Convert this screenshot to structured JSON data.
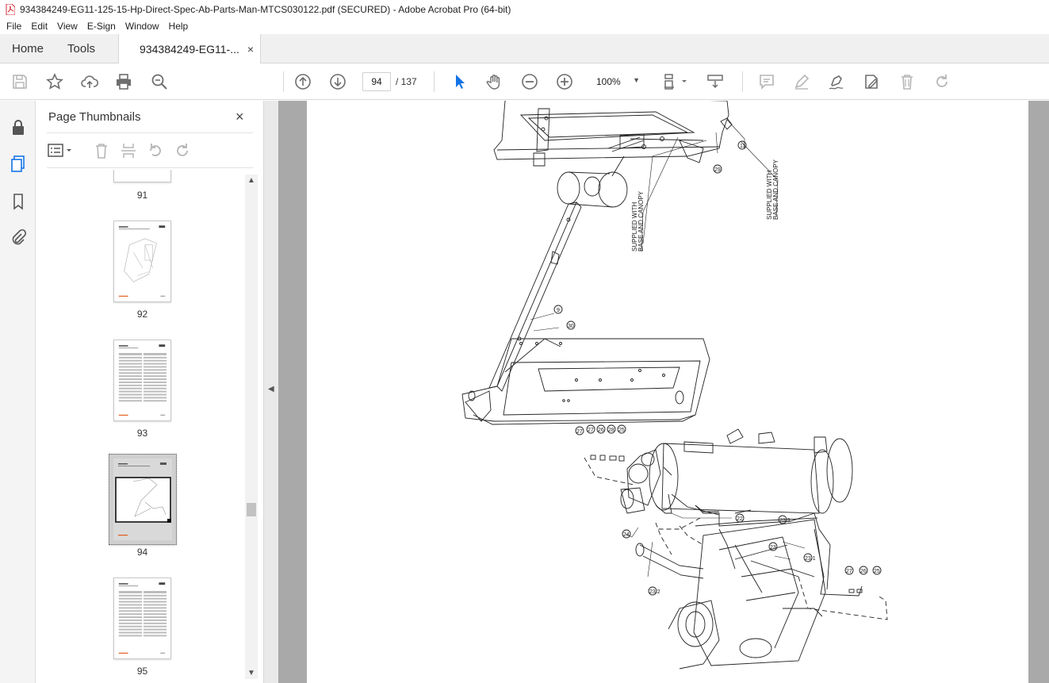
{
  "window": {
    "title": "934384249-EG11-125-15-Hp-Direct-Spec-Ab-Parts-Man-MTCS030122.pdf (SECURED) - Adobe Acrobat Pro (64-bit)"
  },
  "menu": [
    "File",
    "Edit",
    "View",
    "E-Sign",
    "Window",
    "Help"
  ],
  "tabs": {
    "home": "Home",
    "tools": "Tools",
    "document": "934384249-EG11-...",
    "close": "×"
  },
  "toolbar": {
    "current_page": "94",
    "total_pages": "/ 137",
    "zoom": "100%"
  },
  "panel": {
    "title": "Page Thumbnails",
    "close": "×",
    "thumbnails": [
      {
        "label": "91"
      },
      {
        "label": "92"
      },
      {
        "label": "93"
      },
      {
        "label": "94",
        "selected": true
      },
      {
        "label": "95"
      }
    ]
  },
  "drawing": {
    "note_1": "SUPPLIED WITH",
    "note_1b": "BASE AND CANOPY",
    "note_2": "SUPPLIED WITH",
    "note_2b": "BASE AND CANOPY",
    "callouts_top": [
      "29",
      "11"
    ],
    "callouts_mid": [
      "9",
      "30"
    ],
    "callouts_bottom": [
      "27",
      "27",
      "26",
      "28",
      "25",
      "24",
      "22",
      "23.3",
      "23",
      "23.1",
      "23.2",
      "27",
      "26",
      "25"
    ]
  },
  "colors": {
    "accent_blue": "#1473e6",
    "acrobat_red": "#d7282f",
    "icon_grey": "#6e6e6e"
  }
}
